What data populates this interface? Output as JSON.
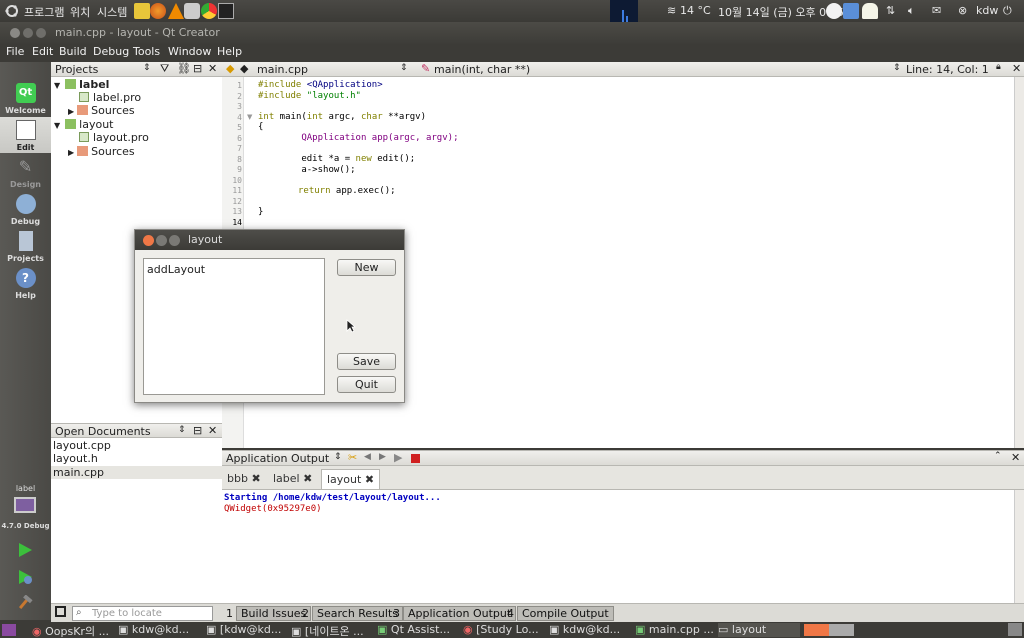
{
  "top_panel": {
    "menu_programs": "프로그램",
    "menu_places": "위치",
    "menu_system": "시스템",
    "weather": "14 °C",
    "datetime": "10월 14일 (금) 오후 01:55",
    "user": "kdw"
  },
  "window_title": "main.cpp - layout - Qt Creator",
  "menubar": [
    "File",
    "Edit",
    "Build",
    "Debug",
    "Tools",
    "Window",
    "Help"
  ],
  "modes": [
    {
      "label": "Welcome",
      "icon": "qt-logo-icon"
    },
    {
      "label": "Edit",
      "icon": "document-icon"
    },
    {
      "label": "Design",
      "icon": "pencil-icon"
    },
    {
      "label": "Debug",
      "icon": "bug-icon"
    },
    {
      "label": "Projects",
      "icon": "book-icon"
    },
    {
      "label": "Help",
      "icon": "help-icon"
    }
  ],
  "target": {
    "project": "label",
    "kit": "4.7.0 Debug"
  },
  "projects_pane": {
    "title": "Projects",
    "tree": [
      {
        "label": "label",
        "type": "project"
      },
      {
        "label": "label.pro",
        "type": "pro-file"
      },
      {
        "label": "Sources",
        "type": "folder"
      },
      {
        "label": "layout",
        "type": "project"
      },
      {
        "label": "layout.pro",
        "type": "pro-file"
      },
      {
        "label": "Sources",
        "type": "folder"
      }
    ]
  },
  "open_documents": {
    "title": "Open Documents",
    "items": [
      "layout.cpp",
      "layout.h",
      "main.cpp"
    ],
    "selected": "main.cpp"
  },
  "editor": {
    "file": "main.cpp",
    "symbol": "main(int, char **)",
    "position": "Line: 14, Col: 1",
    "line_numbers": [
      "1",
      "2",
      "3",
      "4",
      "5",
      "6",
      "7",
      "8",
      "9",
      "10",
      "11",
      "12",
      "13",
      "14"
    ],
    "code": {
      "l1_kw": "#include ",
      "l1_inc": "<QApplication>",
      "l2_kw": "#include ",
      "l2_str": "\"layout.h\"",
      "l4_int": "int",
      "l4_rest": " main(",
      "l4_int2": "int",
      "l4_argc": " argc, ",
      "l4_char": "char",
      "l4_end": " **argv)",
      "l5": "{",
      "l6": "        QApplication app(argc, argv);",
      "l8_a": "        edit *a = ",
      "l8_new": "new",
      "l8_b": " edit();",
      "l9": "        a->show();",
      "l11_ret": "return",
      "l11_b": " app.exec();",
      "l13": "}"
    }
  },
  "output": {
    "title": "Application Output",
    "tabs": [
      "bbb",
      "label",
      "layout"
    ],
    "active_tab": "layout",
    "lines": [
      {
        "text": "Starting /home/kdw/test/layout/layout...",
        "color": "#0000c0"
      },
      {
        "text": "QWidget(0x95297e0)",
        "color": "#c00000"
      }
    ]
  },
  "status_bar": {
    "locator_placeholder": "Type to locate",
    "buttons": [
      {
        "num": "1",
        "label": "Build Issues"
      },
      {
        "num": "2",
        "label": "Search Results"
      },
      {
        "num": "3",
        "label": "Application Output"
      },
      {
        "num": "4",
        "label": "Compile Output"
      }
    ]
  },
  "taskbar": [
    "OopsKr의 ...",
    "kdw@kd...",
    "[kdw@kd...",
    "[네이트온 ...",
    "Qt Assist...",
    "[Study Lo...",
    "kdw@kd...",
    "main.cpp ...",
    "layout"
  ],
  "dialog": {
    "title": "layout",
    "list_items": [
      "addLayout"
    ],
    "buttons": {
      "new": "New",
      "save": "Save",
      "quit": "Quit"
    }
  },
  "colors": {
    "accent_orange": "#f07746",
    "ubuntu_dark": "#3c3b37",
    "output_blue": "#0000c0",
    "output_red": "#c00000"
  }
}
